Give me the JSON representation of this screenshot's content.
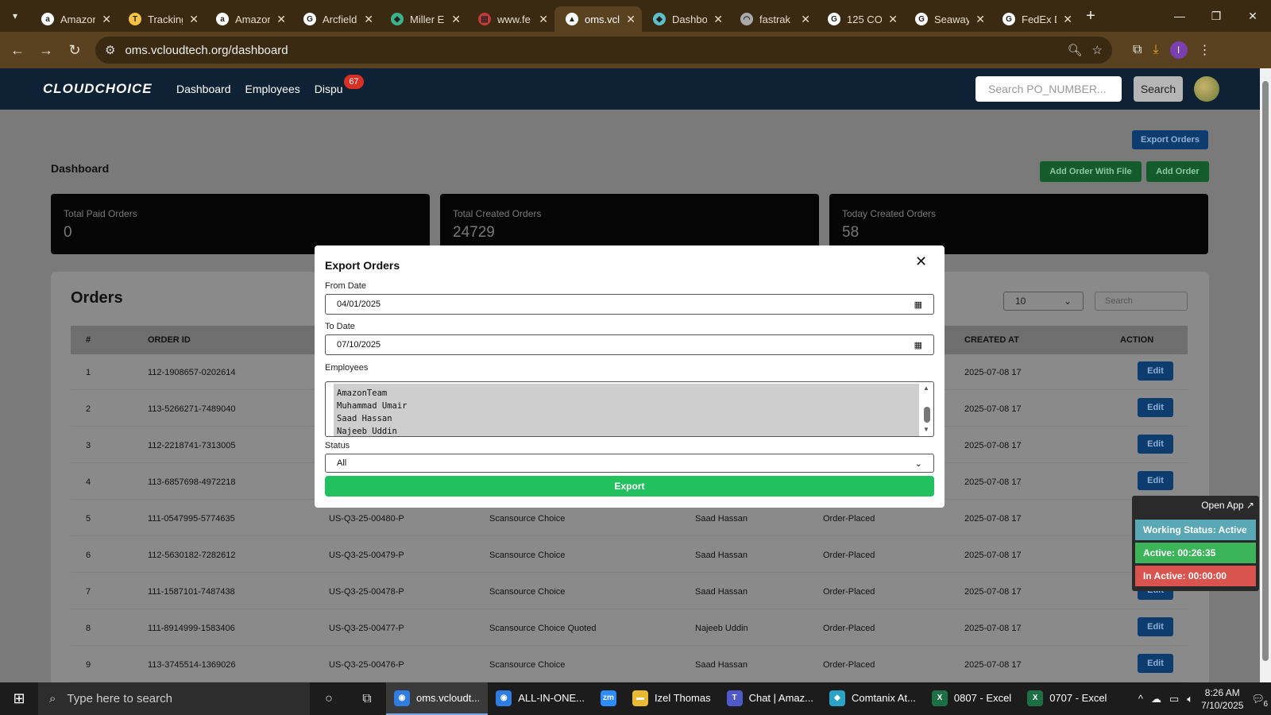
{
  "browser": {
    "tabs": [
      {
        "label": "Amazon",
        "icon": "amazon-icon",
        "active": false
      },
      {
        "label": "Tracking",
        "icon": "tracking-icon",
        "active": false
      },
      {
        "label": "Amazon",
        "icon": "amazon-icon",
        "active": false
      },
      {
        "label": "Arcfield",
        "icon": "google-icon",
        "active": false
      },
      {
        "label": "Miller E",
        "icon": "miller-icon",
        "active": false
      },
      {
        "label": "www.fe",
        "icon": "flag-icon",
        "active": false
      },
      {
        "label": "oms.vcl",
        "icon": "oms-icon",
        "active": true
      },
      {
        "label": "Dashbo",
        "icon": "dashboard-icon",
        "active": false
      },
      {
        "label": "fastrak",
        "icon": "fastrak-icon",
        "active": false
      },
      {
        "label": "125 CO",
        "icon": "google-icon",
        "active": false
      },
      {
        "label": "Seaway",
        "icon": "google-icon",
        "active": false
      },
      {
        "label": "FedEx D",
        "icon": "google-icon",
        "active": false
      }
    ],
    "url": "oms.vcloudtech.org/dashboard",
    "profile_initial": "I"
  },
  "app": {
    "brand": "CLOUDCHOICE",
    "nav": [
      "Dashboard",
      "Employees",
      "Dispu"
    ],
    "dispute_badge": "67",
    "search_placeholder": "Search PO_NUMBER...",
    "search_button": "Search"
  },
  "dashboard": {
    "title": "Dashboard",
    "export_orders": "Export Orders",
    "add_order_with_file": "Add Order With File",
    "add_order": "Add Order",
    "stats": [
      {
        "label": "Total Paid Orders",
        "value": "0"
      },
      {
        "label": "Total Created Orders",
        "value": "24729"
      },
      {
        "label": "Today Created Orders",
        "value": "58"
      }
    ]
  },
  "orders": {
    "title": "Orders",
    "page_size": "10",
    "search_placeholder": "Search",
    "columns": [
      "#",
      "ORDER ID",
      "CREATED AT",
      "ACTION"
    ],
    "edit_label": "Edit",
    "rows": [
      {
        "n": "1",
        "order_id": "112-1908657-0202614",
        "po": "",
        "vendor": "",
        "employee": "",
        "status": "",
        "created": "2025-07-08 17"
      },
      {
        "n": "2",
        "order_id": "113-5266271-7489040",
        "po": "",
        "vendor": "",
        "employee": "",
        "status": "",
        "created": "2025-07-08 17"
      },
      {
        "n": "3",
        "order_id": "112-2218741-7313005",
        "po": "",
        "vendor": "",
        "employee": "",
        "status": "",
        "created": "2025-07-08 17"
      },
      {
        "n": "4",
        "order_id": "113-6857698-4972218",
        "po": "",
        "vendor": "",
        "employee": "",
        "status": "",
        "created": "2025-07-08 17"
      },
      {
        "n": "5",
        "order_id": "111-0547995-5774635",
        "po": "US-Q3-25-00480-P",
        "vendor": "Scansource Choice",
        "employee": "Saad Hassan",
        "status": "Order-Placed",
        "created": "2025-07-08 17"
      },
      {
        "n": "6",
        "order_id": "112-5630182-7282612",
        "po": "US-Q3-25-00479-P",
        "vendor": "Scansource Choice",
        "employee": "Saad Hassan",
        "status": "Order-Placed",
        "created": "2025-07-08 17"
      },
      {
        "n": "7",
        "order_id": "111-1587101-7487438",
        "po": "US-Q3-25-00478-P",
        "vendor": "Scansource Choice",
        "employee": "Saad Hassan",
        "status": "Order-Placed",
        "created": "2025-07-08 17"
      },
      {
        "n": "8",
        "order_id": "111-8914999-1583406",
        "po": "US-Q3-25-00477-P",
        "vendor": "Scansource Choice Quoted",
        "employee": "Najeeb Uddin",
        "status": "Order-Placed",
        "created": "2025-07-08 17"
      },
      {
        "n": "9",
        "order_id": "113-3745514-1369026",
        "po": "US-Q3-25-00476-P",
        "vendor": "Scansource Choice",
        "employee": "Saad Hassan",
        "status": "Order-Placed",
        "created": "2025-07-08 17"
      }
    ]
  },
  "modal": {
    "title": "Export Orders",
    "from_label": "From Date",
    "from_value": "04/01/2025",
    "to_label": "To Date",
    "to_value": "07/10/2025",
    "employees_label": "Employees",
    "employees": [
      "AmazonTeam",
      "Muhammad Umair",
      "Saad Hassan",
      "Najeeb Uddin"
    ],
    "status_label": "Status",
    "status_value": "All",
    "export_button": "Export"
  },
  "widget": {
    "open_app": "Open App ↗",
    "working_status": "Working Status: Active",
    "active": "Active: 00:26:35",
    "inactive": "In Active: 00:00:00",
    "colors": {
      "working": "#5aa7b5",
      "active": "#3cb55a",
      "inactive": "#d9534f"
    }
  },
  "taskbar": {
    "search_placeholder": "Type here to search",
    "apps": [
      {
        "label": "oms.vcloudt...",
        "icon": "chrome-icon",
        "active": true
      },
      {
        "label": "ALL-IN-ONE...",
        "icon": "chrome-icon",
        "active": false
      },
      {
        "label": "",
        "icon": "zoom-icon",
        "active": false
      },
      {
        "label": "Izel Thomas",
        "icon": "folder-icon",
        "active": false
      },
      {
        "label": "Chat | Amaz...",
        "icon": "teams-icon",
        "active": false
      },
      {
        "label": "Comtanix At...",
        "icon": "comtanix-icon",
        "active": false
      },
      {
        "label": "0807 - Excel",
        "icon": "excel-icon",
        "active": false
      },
      {
        "label": "0707 - Excel",
        "icon": "excel-icon",
        "active": false
      }
    ],
    "time": "8:26 AM",
    "date": "7/10/2025",
    "notification_count": "6"
  }
}
